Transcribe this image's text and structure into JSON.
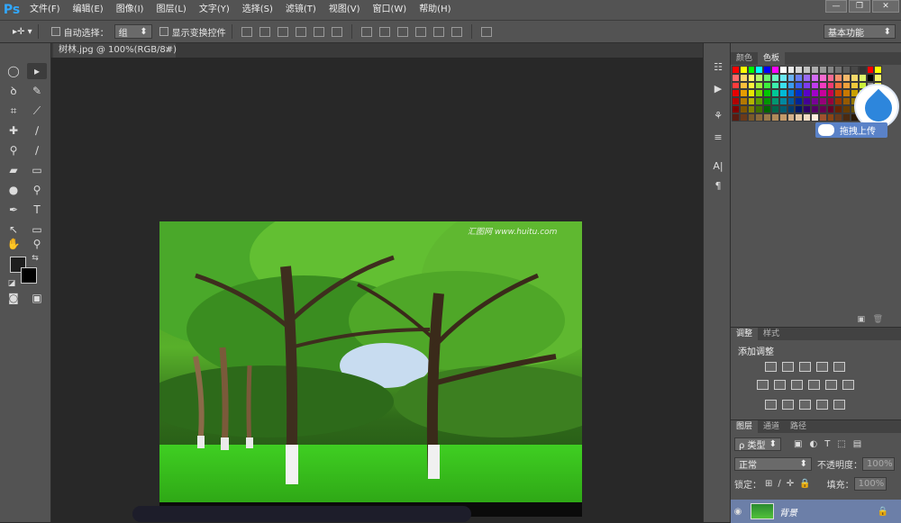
{
  "menubar": {
    "logo": "Ps",
    "items": [
      "文件(F)",
      "编辑(E)",
      "图像(I)",
      "图层(L)",
      "文字(Y)",
      "选择(S)",
      "滤镜(T)",
      "视图(V)",
      "窗口(W)",
      "帮助(H)"
    ]
  },
  "options": {
    "auto_select_label": "自动选择：",
    "auto_select_value": "组",
    "show_transform_label": "显示变换控件",
    "workspace": "基本功能"
  },
  "document": {
    "tab_title": "树林.jpg @ 100%(RGB/8#)",
    "close_glyph": "×",
    "watermark": "汇图网 www.huitu.com"
  },
  "swatches_panel": {
    "tabs": [
      "颜色",
      "色板"
    ],
    "active_tab": "色板",
    "cloud_label": "拖拽上传",
    "colors": [
      "#ff0000",
      "#ffff00",
      "#00ff00",
      "#00ffff",
      "#0000ff",
      "#ff00ff",
      "#ffffff",
      "#ebebeb",
      "#d6d6d6",
      "#c2c2c2",
      "#adadad",
      "#999999",
      "#858585",
      "#707070",
      "#5c5c5c",
      "#474747",
      "#333333",
      "#ff0000",
      "#ffff00",
      "#ff6a6a",
      "#ffd86a",
      "#fff56a",
      "#b7f56a",
      "#6af56a",
      "#6af5c2",
      "#6ae9f5",
      "#6ab2f5",
      "#6a7ff5",
      "#9b6af5",
      "#d36af5",
      "#f56ad1",
      "#f56a94",
      "#f58f6a",
      "#f5b86a",
      "#f5d96a",
      "#dcf56a",
      "#000000",
      "#f5f56a",
      "#ff3b3b",
      "#ffbf3b",
      "#fff03b",
      "#9ef03b",
      "#3bf03b",
      "#3bf0ad",
      "#3be1f0",
      "#3b9cf0",
      "#3b5ef0",
      "#7e3bf0",
      "#c13bf0",
      "#f03bc0",
      "#f03b73",
      "#f0703b",
      "#f0a13b",
      "#f0c93b",
      "#cbf03b",
      "#8a8a8a",
      "#f0f03b",
      "#e60000",
      "#e69c00",
      "#e6e600",
      "#78d600",
      "#00c800",
      "#00c896",
      "#00b9d6",
      "#0078d6",
      "#0030c8",
      "#5a00c8",
      "#a000c8",
      "#c8009c",
      "#c80050",
      "#c84600",
      "#c87800",
      "#c8a000",
      "#a0c800",
      "#606060",
      "#c8c800",
      "#b30000",
      "#b37800",
      "#b3b300",
      "#5a9e00",
      "#009600",
      "#009670",
      "#0088a0",
      "#0058a0",
      "#002496",
      "#440096",
      "#780096",
      "#960078",
      "#96003c",
      "#963400",
      "#965a00",
      "#967800",
      "#789600",
      "#404040",
      "#969600",
      "#800000",
      "#805500",
      "#808000",
      "#3f7000",
      "#006600",
      "#00664c",
      "#005c70",
      "#003c70",
      "#001866",
      "#2e0066",
      "#520066",
      "#660052",
      "#660028",
      "#662300",
      "#663c00",
      "#665200",
      "#526600",
      "#202020",
      "#666600",
      "#5a1a10",
      "#6b3a1a",
      "#7a5a2a",
      "#8a6a3a",
      "#9a7a4a",
      "#b08a5a",
      "#c49a6a",
      "#d4b08a",
      "#e4c8a8",
      "#f0dcc4",
      "#fff0e0",
      "#a0522d",
      "#8b4513",
      "#6b3a1a",
      "#4a2a10",
      "#2a1a08",
      "#c0a080",
      "#d0b090",
      "#e0c0a0"
    ]
  },
  "adjustments_panel": {
    "tabs": [
      "调整",
      "样式"
    ],
    "active_tab": "调整",
    "title": "添加调整"
  },
  "layers_panel": {
    "tabs": [
      "图层",
      "通道",
      "路径"
    ],
    "active_tab": "图层",
    "filter_label": "ρ 类型",
    "blend_mode": "正常",
    "opacity_label": "不透明度：",
    "opacity_value": "100%",
    "lock_label": "锁定：",
    "fill_label": "填充：",
    "fill_value": "100%",
    "layer_name": "背景"
  }
}
